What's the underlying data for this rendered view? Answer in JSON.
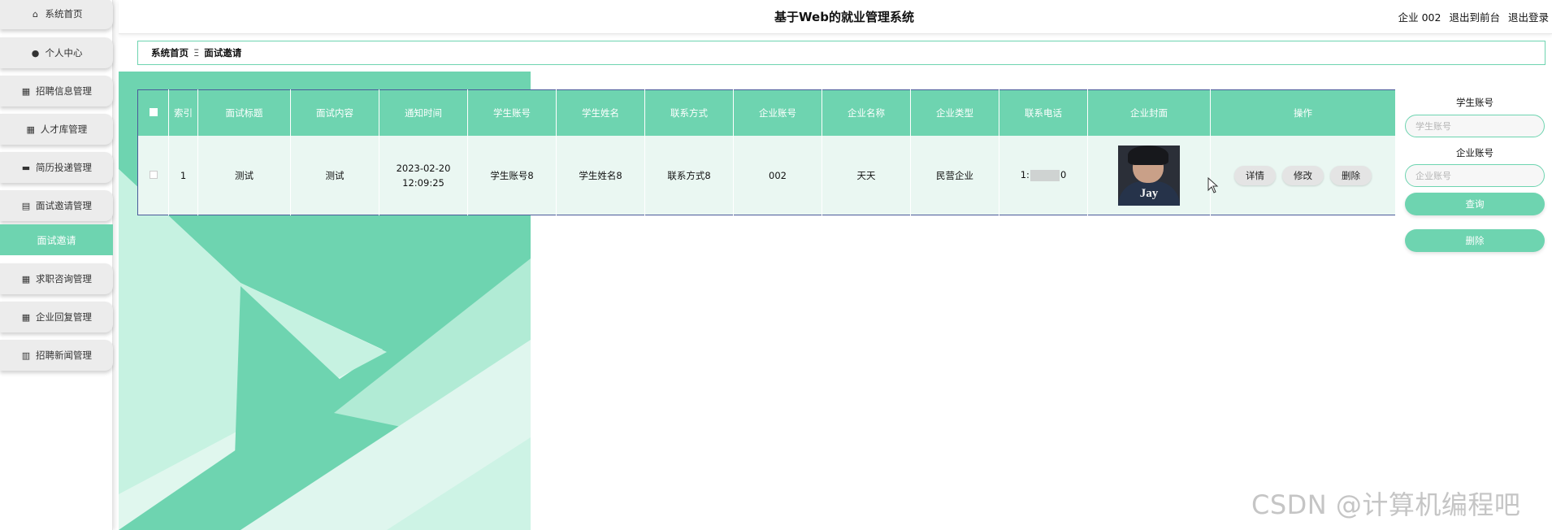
{
  "app": {
    "title": "基于Web的就业管理系统",
    "user_label": "企业 002",
    "link_front": "退出到前台",
    "link_logout": "退出登录"
  },
  "sidebar": {
    "items": [
      {
        "label": "系统首页",
        "icon": "home-icon"
      },
      {
        "label": "个人中心",
        "icon": "user-icon"
      },
      {
        "label": "招聘信息管理",
        "icon": "grid-icon"
      },
      {
        "label": "人才库管理",
        "icon": "grid-icon"
      },
      {
        "label": "简历投递管理",
        "icon": "monitor-icon"
      },
      {
        "label": "面试邀请管理",
        "icon": "clipboard-icon"
      },
      {
        "label": "面试邀请",
        "icon": ""
      },
      {
        "label": "求职咨询管理",
        "icon": "grid-icon"
      },
      {
        "label": "企业回复管理",
        "icon": "grid-icon"
      },
      {
        "label": "招聘新闻管理",
        "icon": "list-grid-icon"
      }
    ]
  },
  "breadcrumb": {
    "home": "系统首页",
    "separator": "Ξ",
    "current": "面试邀请"
  },
  "table": {
    "headers": [
      "",
      "索引",
      "面试标题",
      "面试内容",
      "通知时间",
      "学生账号",
      "学生姓名",
      "联系方式",
      "企业账号",
      "企业名称",
      "企业类型",
      "联系电话",
      "企业封面",
      "操作"
    ],
    "rows": [
      {
        "index": "1",
        "title": "测试",
        "content": "测试",
        "notify_time": "2023-02-20 12:09:25",
        "student_account": "学生账号8",
        "student_name": "学生姓名8",
        "contact": "联系方式8",
        "company_account": "002",
        "company_name": "天天",
        "company_type": "民营企业",
        "phone_prefix": "1:",
        "phone_suffix": "0",
        "cover_text": "Jay",
        "actions": {
          "detail": "详情",
          "edit": "修改",
          "delete": "删除"
        }
      }
    ]
  },
  "search": {
    "student_label": "学生账号",
    "student_placeholder": "学生账号",
    "company_label": "企业账号",
    "company_placeholder": "企业账号",
    "query_button": "查询",
    "delete_button": "删除"
  },
  "watermark": "CSDN @计算机编程吧",
  "colors": {
    "accent": "#6ed4b0",
    "row_bg": "#eaf7f2"
  }
}
